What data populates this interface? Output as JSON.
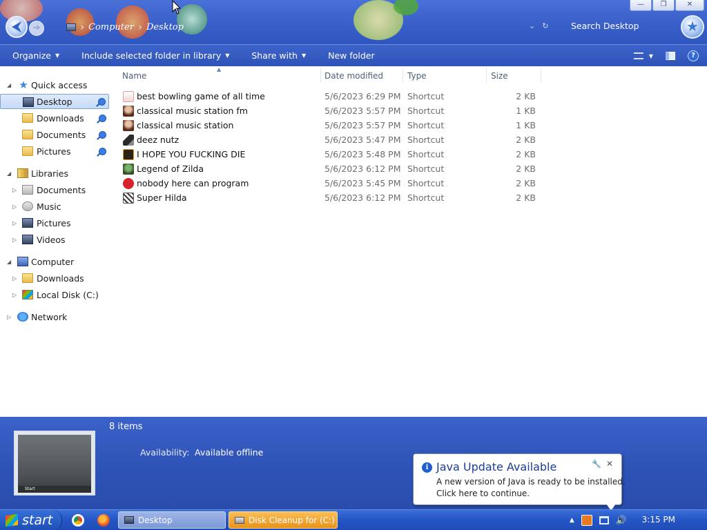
{
  "window": {
    "minimize": "—",
    "maximize": "❐",
    "close": "✕"
  },
  "address": {
    "crumbs": [
      "Computer",
      "Desktop"
    ],
    "search_placeholder": "Search Desktop"
  },
  "toolbar": {
    "organize": "Organize",
    "include_library": "Include selected folder in library",
    "share_with": "Share with",
    "new_folder": "New folder",
    "help": "?"
  },
  "nav": {
    "quick_access": "Quick access",
    "qa_items": [
      "Desktop",
      "Downloads",
      "Documents",
      "Pictures"
    ],
    "libraries": "Libraries",
    "lib_items": [
      "Documents",
      "Music",
      "Pictures",
      "Videos"
    ],
    "computer": "Computer",
    "comp_items": [
      "Downloads",
      "Local Disk (C:)"
    ],
    "network": "Network"
  },
  "columns": {
    "name": "Name",
    "date": "Date modified",
    "type": "Type",
    "size": "Size"
  },
  "files": [
    {
      "name": "best bowling game of all time",
      "date": "5/6/2023 6:29 PM",
      "type": "Shortcut",
      "size": "2 KB"
    },
    {
      "name": "classical music station fm",
      "date": "5/6/2023 5:57 PM",
      "type": "Shortcut",
      "size": "1 KB"
    },
    {
      "name": "classical music station",
      "date": "5/6/2023 5:57 PM",
      "type": "Shortcut",
      "size": "1 KB"
    },
    {
      "name": "deez nutz",
      "date": "5/6/2023 5:47 PM",
      "type": "Shortcut",
      "size": "2 KB"
    },
    {
      "name": "I HOPE YOU FUCKING DIE",
      "date": "5/6/2023 5:48 PM",
      "type": "Shortcut",
      "size": "2 KB"
    },
    {
      "name": "Legend of Zilda",
      "date": "5/6/2023 6:12 PM",
      "type": "Shortcut",
      "size": "2 KB"
    },
    {
      "name": "nobody here can program",
      "date": "5/6/2023 5:45 PM",
      "type": "Shortcut",
      "size": "2 KB"
    },
    {
      "name": "Super Hilda",
      "date": "5/6/2023 6:12 PM",
      "type": "Shortcut",
      "size": "2 KB"
    }
  ],
  "details": {
    "count": "8 items",
    "availability_label": "Availability:",
    "availability_value": "Available offline",
    "thumb_start": "Start"
  },
  "balloon": {
    "info": "i",
    "title": "Java Update Available",
    "line1": "A new version of Java is ready to be installed.",
    "line2": "Click here to continue.",
    "close": "✕"
  },
  "taskbar": {
    "start": "start",
    "task_desktop": "Desktop",
    "task_disk": "Disk Cleanup for  (C:)",
    "clock": "3:15 PM"
  },
  "colors": {
    "chrome_blue": "#2f56be",
    "taskbar_orange": "#e8921a"
  }
}
